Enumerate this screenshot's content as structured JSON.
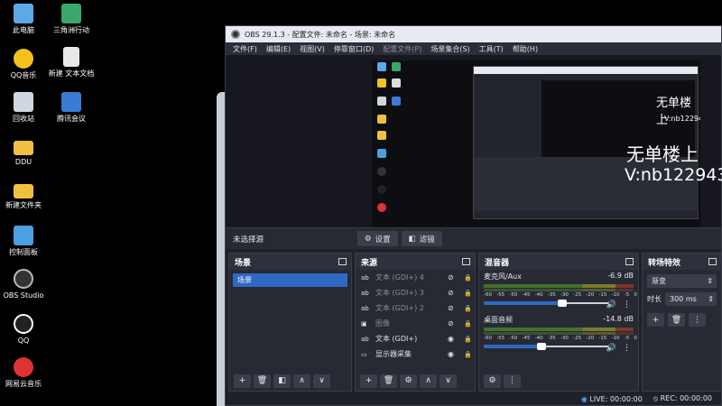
{
  "desktop": {
    "icons": [
      {
        "label": "此电脑",
        "color": "#5fa8e8"
      },
      {
        "label": "三角洲行动",
        "color": "#3aa86a"
      },
      {
        "label": "QQ音乐",
        "color": "#f5c21b"
      },
      {
        "label": "新建 文本文档",
        "color": "#e8e8e8"
      },
      {
        "label": "回收站",
        "color": "#cfd8e0"
      },
      {
        "label": "腾讯会议",
        "color": "#3a7bd5"
      },
      {
        "label": "DDU",
        "color": "#f0c040"
      },
      {
        "label": "新建文件夹",
        "color": "#f0c040"
      },
      {
        "label": "控制面板",
        "color": "#4aa0e0"
      },
      {
        "label": "OBS Studio",
        "color": "#444"
      },
      {
        "label": "QQ",
        "color": "#111"
      },
      {
        "label": "网易云音乐",
        "color": "#d33"
      }
    ]
  },
  "window": {
    "title": "OBS 29.1.3 - 配置文件: 未命名 - 场景: 未命名",
    "menu": [
      "文件(F)",
      "编辑(E)",
      "视图(V)",
      "停靠窗口(D)",
      "配置文件(P)",
      "场景集合(S)",
      "工具(T)",
      "帮助(H)"
    ]
  },
  "preview": {
    "overlay_small1": "无单楼上",
    "overlay_small2": "V:nb12294",
    "overlay_large1": "无单楼上",
    "overlay_large2": "V:nb122943"
  },
  "source_toolbar": {
    "no_selection": "未选择源",
    "settings": "设置",
    "filters": "滤镜"
  },
  "scenes": {
    "title": "场景",
    "items": [
      "场景"
    ]
  },
  "sources": {
    "title": "来源",
    "items": [
      {
        "name": "文本 (GDI+) 4",
        "icon": "ab",
        "visible": false
      },
      {
        "name": "文本 (GDI+) 3",
        "icon": "ab",
        "visible": false
      },
      {
        "name": "文本 (GDI+) 2",
        "icon": "ab",
        "visible": false
      },
      {
        "name": "图像",
        "icon": "img",
        "visible": false
      },
      {
        "name": "文本 (GDI+)",
        "icon": "ab",
        "visible": true
      },
      {
        "name": "显示器采集",
        "icon": "mon",
        "visible": true
      }
    ]
  },
  "mixer": {
    "title": "混音器",
    "channels": [
      {
        "name": "麦克风/Aux",
        "db": "-6.9 dB",
        "volume": 0.62
      },
      {
        "name": "桌面音频",
        "db": "-14.8 dB",
        "volume": 0.46
      }
    ],
    "ticks": [
      "-60",
      "-55",
      "-50",
      "-45",
      "-40",
      "-35",
      "-30",
      "-25",
      "-20",
      "-15",
      "-10",
      "-5",
      "0"
    ]
  },
  "transitions": {
    "title": "转场特效",
    "selected": "渐变",
    "duration_label": "时长",
    "duration_value": "300 ms"
  },
  "status": {
    "live": "LIVE: 00:00:00",
    "rec": "REC: 00:00:00"
  }
}
